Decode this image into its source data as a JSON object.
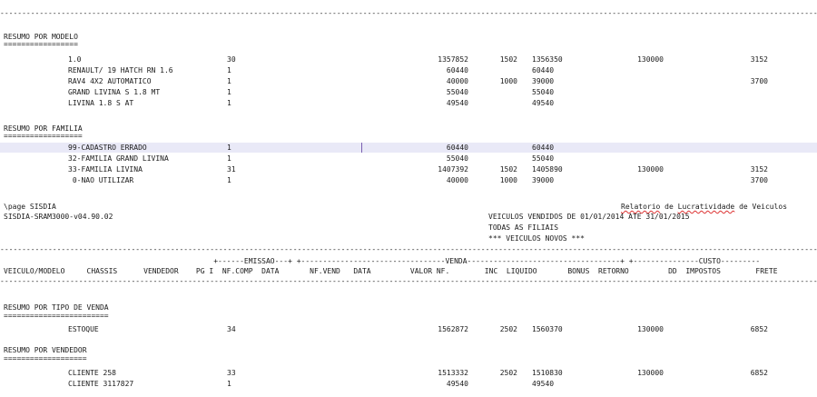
{
  "top_rule": "--------------------------------------------------------------------------------------------------------------------------------------------------------------------------------------------------------------",
  "modelo": {
    "title": "RESUMO POR MODELO",
    "underline": "=================",
    "rows": [
      {
        "name": "1.0",
        "qty": "30",
        "valor": "1357852",
        "inc": "1502",
        "liquido": "1356350",
        "retorno": "130000",
        "impostos": "3152",
        "frete": ""
      },
      {
        "name": "RENAULT/ 19 HATCH RN 1.6",
        "qty": "1",
        "valor": "60440",
        "inc": "",
        "liquido": "60440",
        "retorno": "",
        "impostos": "",
        "frete": ""
      },
      {
        "name": "RAV4 4X2 AUTOMATICO",
        "qty": "1",
        "valor": "40000",
        "inc": "1000",
        "liquido": "39000",
        "retorno": "",
        "impostos": "",
        "frete": "3700"
      },
      {
        "name": "GRAND LIVINA S 1.8 MT",
        "qty": "1",
        "valor": "55040",
        "inc": "",
        "liquido": "55040",
        "retorno": "",
        "impostos": "",
        "frete": ""
      },
      {
        "name": "LIVINA 1.8 S AT",
        "qty": "1",
        "valor": "49540",
        "inc": "",
        "liquido": "49540",
        "retorno": "",
        "impostos": "",
        "frete": ""
      }
    ]
  },
  "familia": {
    "title": "RESUMO POR FAMILIA",
    "underline": "==================",
    "rows": [
      {
        "name": "99-CADASTRO ERRADO",
        "qty": "1",
        "valor": "60440",
        "inc": "",
        "liquido": "60440",
        "retorno": "",
        "impostos": "",
        "frete": ""
      },
      {
        "name": "32-FAMILIA GRAND LIVINA",
        "qty": "1",
        "valor": "55040",
        "inc": "",
        "liquido": "55040",
        "retorno": "",
        "impostos": "",
        "frete": ""
      },
      {
        "name": "33-FAMILIA LIVINA",
        "qty": "31",
        "valor": "1407392",
        "inc": "1502",
        "liquido": "1405890",
        "retorno": "130000",
        "impostos": "3152",
        "frete": ""
      },
      {
        "name": " 0-NAO UTILIZAR",
        "qty": "1",
        "valor": "40000",
        "inc": "1000",
        "liquido": "39000",
        "retorno": "",
        "impostos": "",
        "frete": "3700"
      }
    ]
  },
  "header": {
    "page_line": "\\page SISDIA",
    "system": "SISDIA-SRAM3000-v04.90.02",
    "report_prefix": "Relatorio",
    "report_de": " de ",
    "report_lucr": "Lucratividade",
    "report_suffix": " de Veiculos",
    "line1": "VEICULOS VENDIDOS DE 01/01/2014 ATE 31/01/2015",
    "line2": "TODAS AS FILIAIS",
    "line3": "*** VEICULOS NOVOS ***"
  },
  "columns": {
    "rule1": "--------------------------------------------------------------------------------------------------------------------------------------------------------------------------------------------------------------",
    "group_line": "                                                +------EMISSAO---+ +---------------------------------VENDA-----------------------------------+ +---------------CUSTO---------",
    "headers": "VEICULO/MODELO     CHASSIS      VENDEDOR    PG I  NF.COMP  DATA       NF.VEND   DATA         VALOR NF.        INC  LIQUIDO       BONUS  RETORNO         DD  IMPOSTOS        FRETE",
    "rule2": "--------------------------------------------------------------------------------------------------------------------------------------------------------------------------------------------------------------"
  },
  "tipo_venda": {
    "title": "RESUMO POR TIPO DE VENDA",
    "underline": "========================",
    "rows": [
      {
        "name": "ESTOQUE",
        "qty": "34",
        "valor": "1562872",
        "inc": "2502",
        "liquido": "1560370",
        "retorno": "130000",
        "impostos": "6852",
        "frete": ""
      }
    ]
  },
  "vendedor": {
    "title": "RESUMO POR VENDEDOR",
    "underline": "===================",
    "rows": [
      {
        "name": "CLIENTE 258",
        "qty": "33",
        "valor": "1513332",
        "inc": "2502",
        "liquido": "1510830",
        "retorno": "130000",
        "impostos": "6852",
        "frete": ""
      },
      {
        "name": "CLIENTE 3117827",
        "qty": "1",
        "valor": "49540",
        "inc": "",
        "liquido": "49540",
        "retorno": "",
        "impostos": "",
        "frete": ""
      }
    ]
  },
  "colors": {
    "highlight": "#e9e9f7",
    "caret": "#7a5fb0",
    "text": "#1a1a1a"
  }
}
